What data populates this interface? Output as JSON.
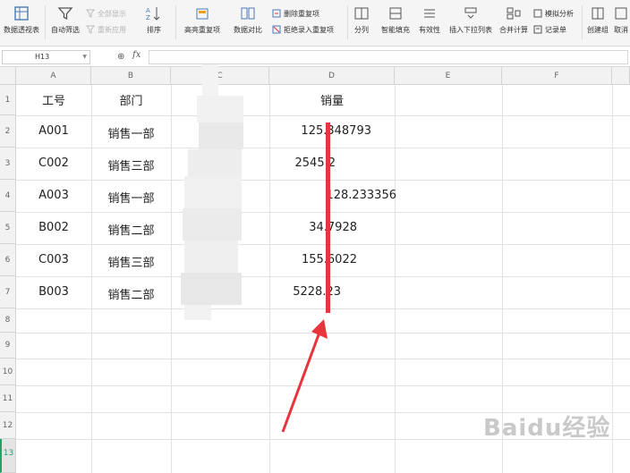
{
  "ribbon": {
    "pivot_table": "数据透视表",
    "auto_filter": "自动筛选",
    "show_all": "全部显示",
    "reapply": "重新应用",
    "sort": "排序",
    "highlight_duplicates": "高亮重复项",
    "data_compare": "数据对比",
    "remove_duplicates": "删除重复项",
    "reject_duplicates": "拒绝录入重复项",
    "split": "分列",
    "smart_fill": "智能填充",
    "validity": "有效性",
    "insert_dropdown": "插入下拉列表",
    "consolidate": "合并计算",
    "simulate": "模拟分析",
    "record_sheet": "记录单",
    "create_group": "创建组",
    "ungroup": "取消"
  },
  "formula_bar": {
    "cell_ref": "H13",
    "fx": "fx",
    "formula": ""
  },
  "columns": [
    "A",
    "B",
    "C",
    "D",
    "E",
    "F"
  ],
  "rows": [
    "1",
    "2",
    "3",
    "4",
    "5",
    "6",
    "7",
    "8",
    "9",
    "10",
    "11",
    "12",
    "13"
  ],
  "active_row": "13",
  "table": {
    "headers": {
      "a": "工号",
      "b": "部门",
      "d": "销量"
    },
    "rows": [
      {
        "a": "A001",
        "b": "销售一部",
        "d": "125.348793"
      },
      {
        "a": "C002",
        "b": "销售三部",
        "d": "2545.2"
      },
      {
        "a": "A003",
        "b": "销售一部",
        "d": "128.233356"
      },
      {
        "a": "B002",
        "b": "销售二部",
        "d": "34.7928"
      },
      {
        "a": "C003",
        "b": "销售三部",
        "d": "155.6022"
      },
      {
        "a": "B003",
        "b": "销售二部",
        "d": "5228.23"
      }
    ]
  },
  "watermark": "Baidu经验",
  "colors": {
    "highlight": "#e8343c",
    "active_row": "#21a366"
  }
}
